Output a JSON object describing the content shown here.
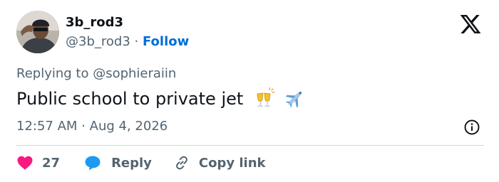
{
  "author": {
    "display_name": "3b_rod3",
    "handle": "@3b_rod3",
    "separator": "·",
    "follow_label": "Follow"
  },
  "reply_context": "Replying to @sophieraiin",
  "tweet": {
    "text": "Public school to private jet",
    "emojis": [
      "clinking-glasses-icon",
      "airplane-icon"
    ]
  },
  "timestamp": {
    "time": "12:57 AM",
    "separator": "·",
    "date": "Aug 4, 2026"
  },
  "actions": {
    "like_count": "27",
    "reply_label": "Reply",
    "copy_link_label": "Copy link"
  },
  "colors": {
    "accent": "#006fd6",
    "like": "#f91880",
    "reply_bubble": "#1d9bf0",
    "muted": "#536471",
    "text": "#0f1419"
  }
}
